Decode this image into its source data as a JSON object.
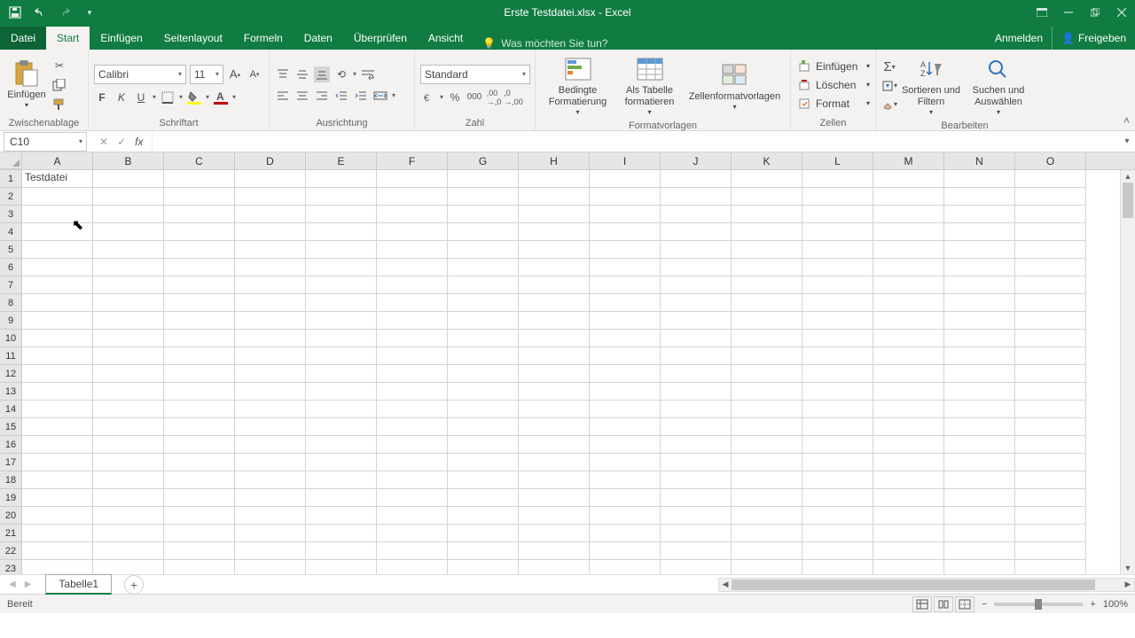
{
  "title": "Erste Testdatei.xlsx - Excel",
  "tabs": {
    "file": "Datei",
    "start": "Start",
    "insert": "Einfügen",
    "pagelayout": "Seitenlayout",
    "formulas": "Formeln",
    "data": "Daten",
    "review": "Überprüfen",
    "view": "Ansicht",
    "tellme": "Was möchten Sie tun?",
    "signin": "Anmelden",
    "share": "Freigeben"
  },
  "ribbon": {
    "clipboard": {
      "label": "Zwischenablage",
      "paste": "Einfügen"
    },
    "font": {
      "label": "Schriftart",
      "name": "Calibri",
      "size": "11",
      "bold": "F",
      "italic": "K",
      "underline": "U"
    },
    "alignment": {
      "label": "Ausrichtung"
    },
    "number": {
      "label": "Zahl",
      "format": "Standard"
    },
    "styles": {
      "label": "Formatvorlagen",
      "conditional": "Bedingte Formatierung",
      "astable": "Als Tabelle formatieren",
      "cellstyles": "Zellenformatvorlagen"
    },
    "cells": {
      "label": "Zellen",
      "insert": "Einfügen",
      "delete": "Löschen",
      "format": "Format"
    },
    "editing": {
      "label": "Bearbeiten",
      "sort": "Sortieren und Filtern",
      "find": "Suchen und Auswählen"
    }
  },
  "namebox": "C10",
  "columns": [
    "A",
    "B",
    "C",
    "D",
    "E",
    "F",
    "G",
    "H",
    "I",
    "J",
    "K",
    "L",
    "M",
    "N",
    "O"
  ],
  "rows": [
    "1",
    "2",
    "3",
    "4",
    "5",
    "6",
    "7",
    "8",
    "9",
    "10",
    "11",
    "12",
    "13",
    "14",
    "15",
    "16",
    "17",
    "18",
    "19",
    "20",
    "21",
    "22",
    "23"
  ],
  "cells": {
    "A1": "Testdatei"
  },
  "sheet": {
    "name": "Tabelle1"
  },
  "status": {
    "ready": "Bereit",
    "zoom": "100%"
  }
}
